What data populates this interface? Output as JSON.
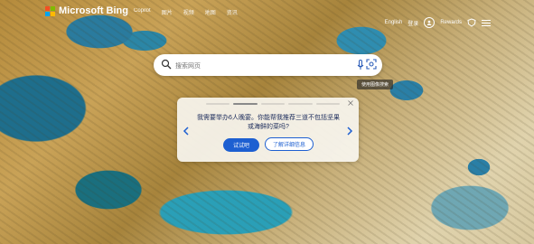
{
  "brand": {
    "name": "Microsoft Bing"
  },
  "nav": {
    "tabs": [
      "Copilot",
      "图片",
      "视频",
      "地图",
      "资讯"
    ]
  },
  "account": {
    "language": "English",
    "signin": "登录",
    "rewards": "Rewards"
  },
  "search": {
    "placeholder": "搜索网页",
    "visual_tooltip": "使用图像搜索"
  },
  "quiz": {
    "question": "我需要举办6人晚宴。你能帮我推荐三道不包括坚果或海鲜的菜吗?",
    "try_label": "试试吧",
    "learn_label": "了解详细信息",
    "progress_steps": 5,
    "progress_active": 1
  },
  "icons": [
    "search-icon",
    "mic-icon",
    "visual-search-icon",
    "close-icon",
    "chevron-left-icon",
    "chevron-right-icon",
    "shield-icon",
    "menu-icon",
    "avatar-icon"
  ]
}
